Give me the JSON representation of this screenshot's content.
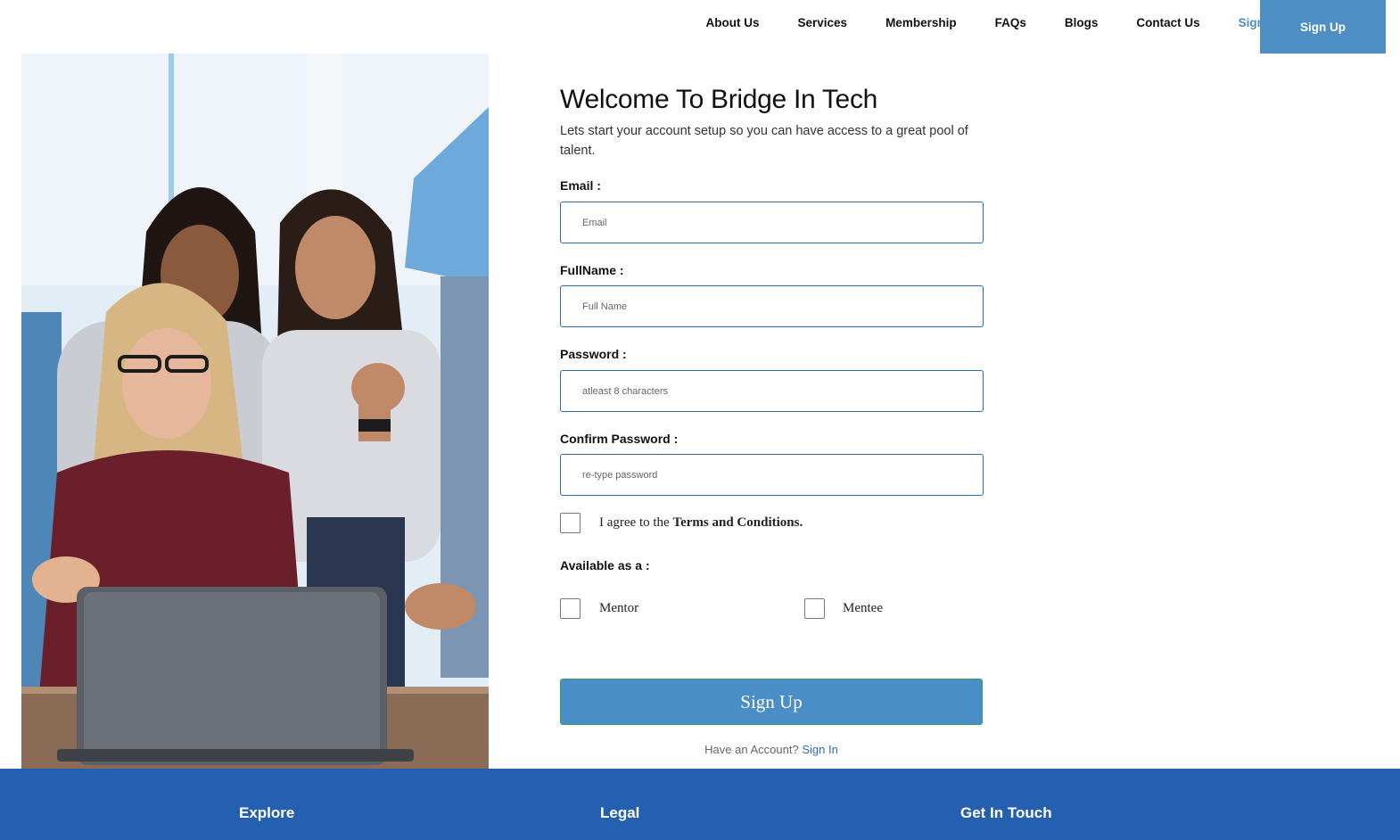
{
  "nav": {
    "links": [
      "About Us",
      "Services",
      "Membership",
      "FAQs",
      "Blogs",
      "Contact Us"
    ],
    "signin": "Sign In",
    "signup": "Sign Up"
  },
  "form": {
    "title": "Welcome To Bridge In Tech",
    "subtitle": "Lets start your account setup so you can have access to a great pool of talent.",
    "email": {
      "label": "Email :",
      "placeholder": "Email",
      "value": ""
    },
    "fullname": {
      "label": "FullName :",
      "placeholder": "Full Name",
      "value": ""
    },
    "password": {
      "label": "Password :",
      "placeholder": "atleast 8 characters",
      "value": ""
    },
    "confirm": {
      "label": "Confirm Password :",
      "placeholder": "re-type password",
      "value": ""
    },
    "terms": {
      "prefix": "I agree to the ",
      "link": "Terms and Conditions.",
      "checked": false
    },
    "available_label": "Available as a :",
    "roles": [
      {
        "label": "Mentor",
        "checked": false
      },
      {
        "label": "Mentee",
        "checked": false
      }
    ],
    "submit": "Sign Up",
    "have_account": "Have an Account?",
    "signin_link": "Sign In"
  },
  "footer": {
    "columns": [
      "Explore",
      "Legal",
      "Get In Touch"
    ]
  },
  "colors": {
    "accent": "#4d8ec4",
    "input_border": "#2c6cb5",
    "footer_bg": "#2560b0"
  }
}
